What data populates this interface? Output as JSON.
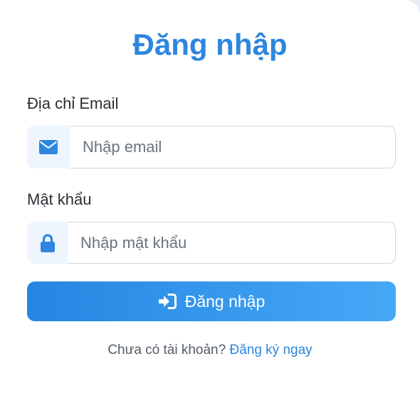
{
  "login": {
    "title": "Đăng nhập",
    "email_label": "Địa chỉ Email",
    "email_placeholder": "Nhập email",
    "email_value": "",
    "email_icon": "envelope-icon",
    "password_label": "Mật khẩu",
    "password_placeholder": "Nhập mật khẩu",
    "password_value": "",
    "password_icon": "lock-icon",
    "submit_label": "Đăng nhập",
    "submit_icon": "sign-in-icon",
    "footer_text": "Chưa có tài khoản?",
    "register_link": "Đăng ký ngay"
  },
  "colors": {
    "accent": "#2e86de",
    "button_start": "#2586e2",
    "button_end": "#45a8f6",
    "addon_bg": "#eef5fd",
    "border": "#cfd5dd"
  }
}
